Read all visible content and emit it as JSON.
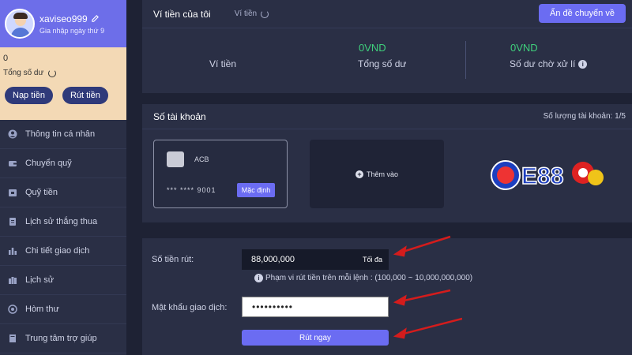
{
  "profile": {
    "username": "xaviseo999",
    "joined": "Gia nhập ngày thứ 9"
  },
  "balance": {
    "value": "0",
    "label": "Tổng số dư",
    "deposit_label": "Nạp tiền",
    "withdraw_label": "Rút tiền"
  },
  "sidebar": {
    "items": [
      {
        "label": "Thông tin cá nhân",
        "icon": "user-icon"
      },
      {
        "label": "Chuyển quỹ",
        "icon": "wallet-icon"
      },
      {
        "label": "Quỹ tiền",
        "icon": "fund-icon"
      },
      {
        "label": "Lịch sử thắng thua",
        "icon": "document-icon"
      },
      {
        "label": "Chi tiết giao dịch",
        "icon": "bar-chart-icon"
      },
      {
        "label": "Lịch sử",
        "icon": "history-icon"
      },
      {
        "label": "Hòm thư",
        "icon": "mailbox-icon"
      },
      {
        "label": "Trung tâm trợ giúp",
        "icon": "help-book-icon"
      }
    ]
  },
  "wallet": {
    "title": "Ví tiền của tôi",
    "subtitle": "Ví tiền",
    "hide_button": "Ẩn đề chuyển về",
    "row_label": "Ví tiền",
    "total_value": "0VND",
    "total_label": "Tổng số dư",
    "pending_value": "0VND",
    "pending_label": "Số dư chờ xử lí"
  },
  "accounts": {
    "title": "Số tài khoản",
    "count_label": "Số lượng tài khoản:",
    "count_value": "1/5",
    "card": {
      "bank": "ACB",
      "number": "*** **** 9001",
      "badge": "Mặc định"
    },
    "add_label": "Thêm vào",
    "logo_text": "E88"
  },
  "withdraw": {
    "amount_label": "Số tiền rút:",
    "amount_value": "88,000,000",
    "max_label": "Tối đa",
    "range_note": "Phạm vi rút tiền trên mỗi lệnh : (100,000 ~ 10,000,000,000)",
    "password_label": "Mật khẩu giao dịch:",
    "password_value": "••••••••••",
    "submit_label": "Rút ngay"
  },
  "colors": {
    "accent": "#6b6cf2",
    "positive": "#3fd07c",
    "arrow": "#d41c1c",
    "profile_bg": "#6d6ee9",
    "balance_bg": "#f3d9b5"
  }
}
